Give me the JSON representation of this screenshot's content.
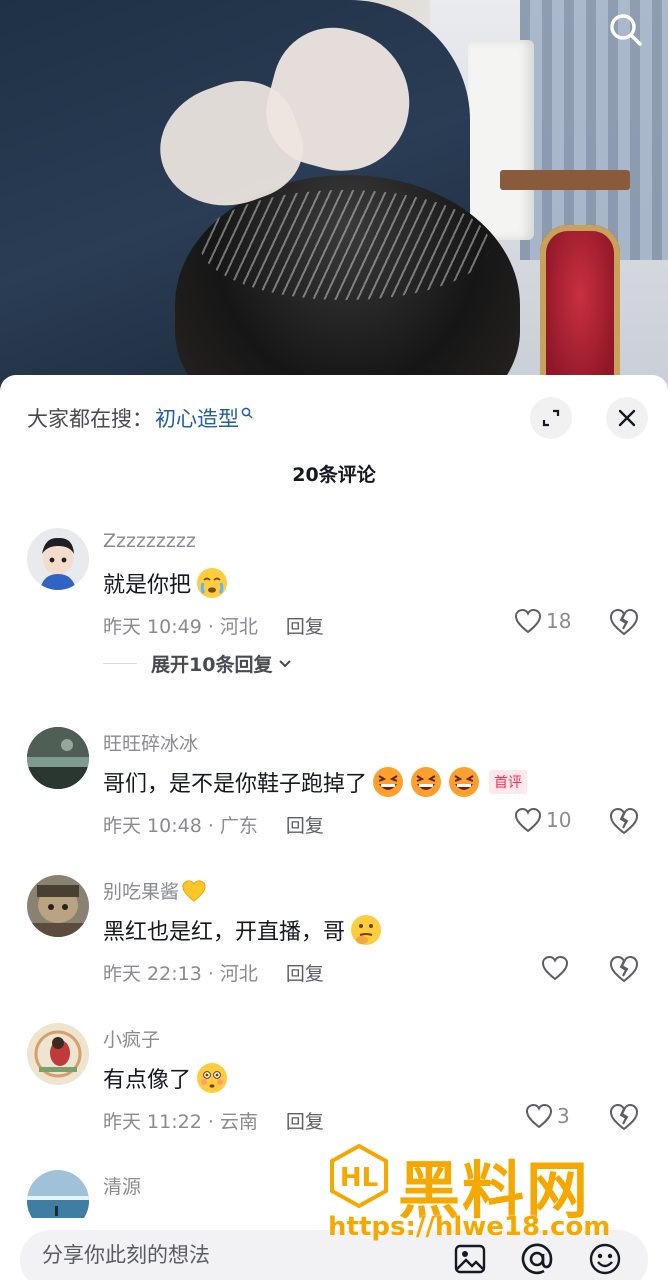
{
  "hot_search": {
    "prefix": "大家都在搜：",
    "term": "初心造型"
  },
  "comment_count": "20条评论",
  "comments": [
    {
      "name": "Zzzzzzzzz",
      "text": "就是你把",
      "time": "昨天 10:49 · 河北",
      "reply": "回复",
      "likes": "18",
      "emoji": "crying-face"
    },
    {
      "name": "旺旺碎冰冰",
      "text": "哥们，是不是你鞋子跑掉了",
      "time": "昨天 10:48 · 广东",
      "reply": "回复",
      "likes": "10",
      "badge": "首评",
      "emoji": "laughing-face"
    },
    {
      "name": "别吃果酱",
      "text": "黑红也是红，开直播，哥",
      "time": "昨天 22:13 · 河北",
      "reply": "回复",
      "likes": "",
      "emoji": "thinking-face"
    },
    {
      "name": "小疯子",
      "text": "有点像了",
      "time": "昨天 11:22 · 云南",
      "reply": "回复",
      "likes": "3",
      "emoji": "flushed-face"
    },
    {
      "name": "清源",
      "text": ""
    }
  ],
  "expand_replies": "展开10条回复",
  "input": {
    "placeholder": "分享你此刻的想法"
  },
  "watermark": {
    "title": "黑料网",
    "url": "https://hlwe18.com"
  },
  "colors": {
    "link": "#1f5fa8",
    "badge": "#fe2c55",
    "watermark": "#f7a800"
  }
}
